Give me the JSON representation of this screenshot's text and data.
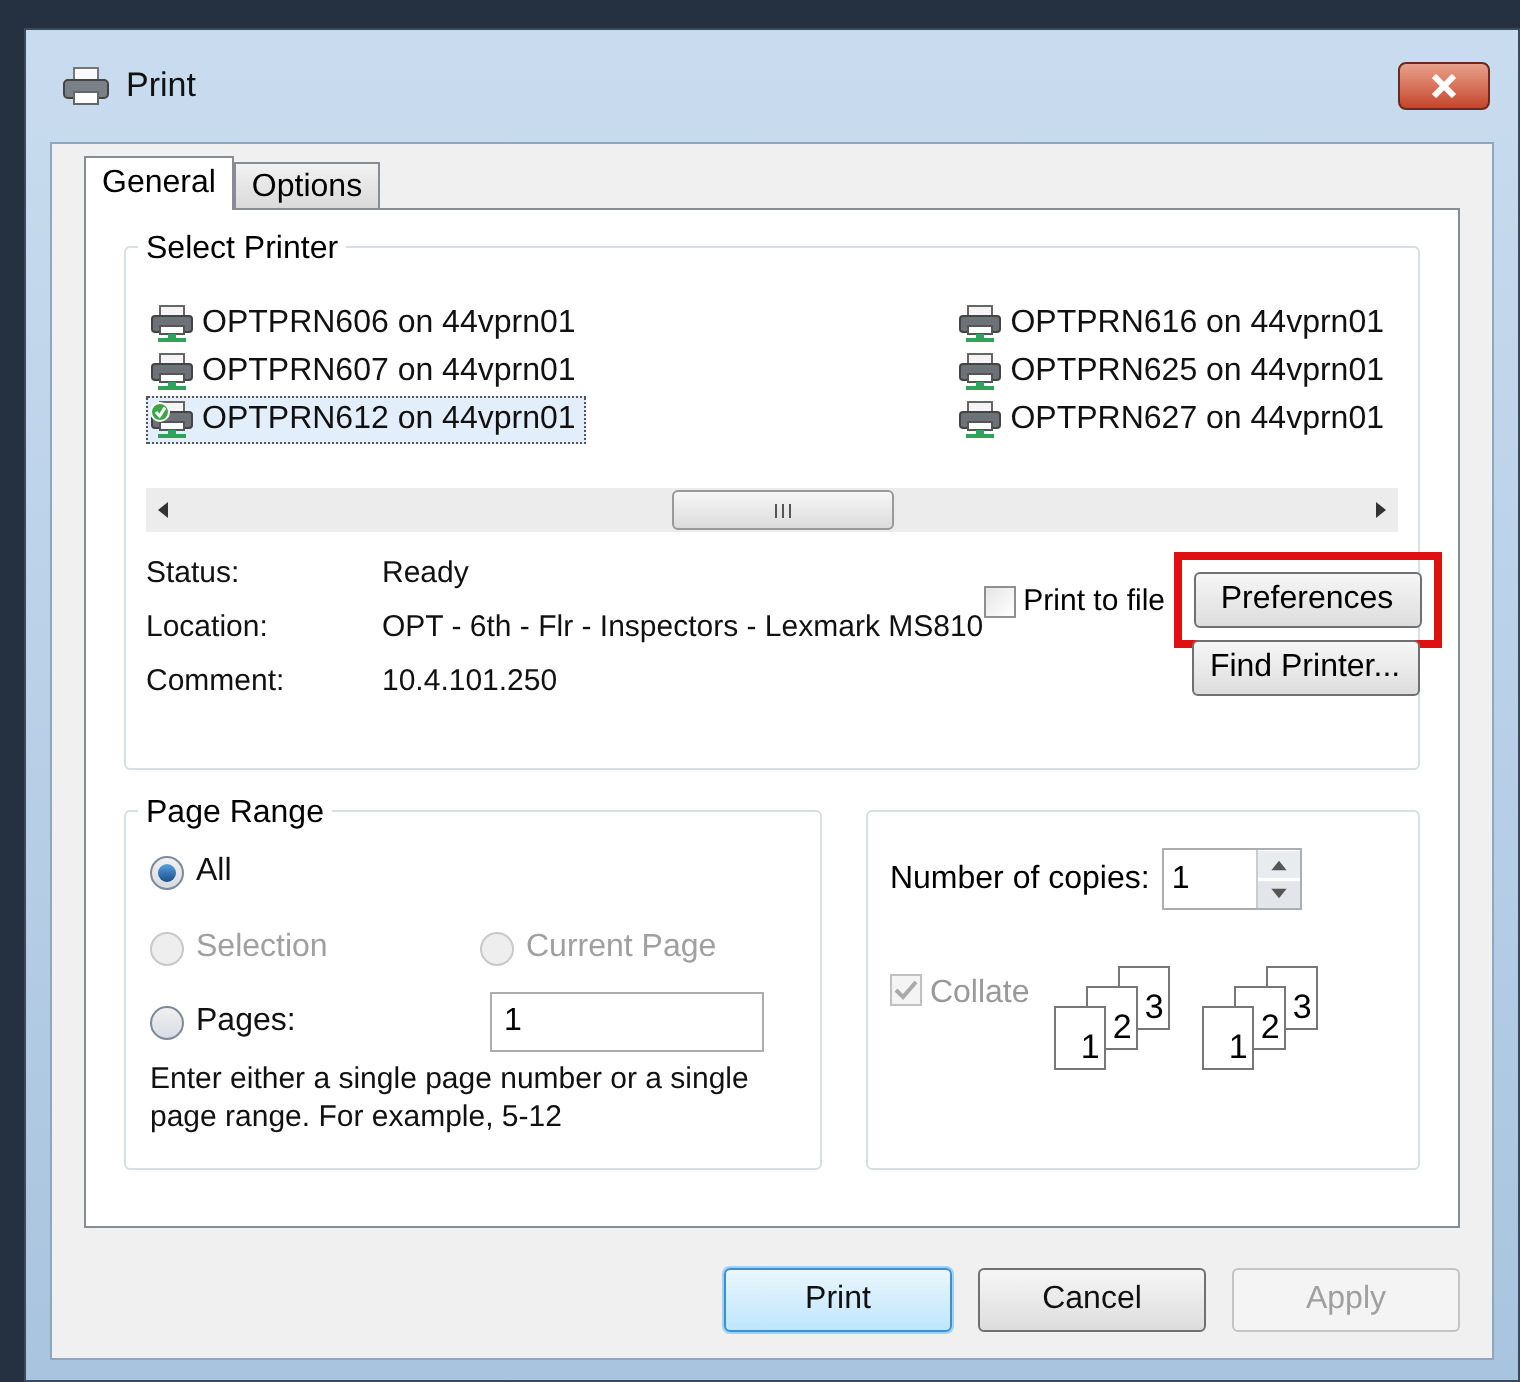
{
  "window": {
    "title": "Print"
  },
  "tabs": [
    {
      "label": "General",
      "selected": true
    },
    {
      "label": "Options",
      "selected": false
    }
  ],
  "select_printer": {
    "title": "Select Printer",
    "printers": [
      {
        "name": "OPTPRN606 on 44vprn01",
        "selected": false,
        "default": false
      },
      {
        "name": "OPTPRN607 on 44vprn01",
        "selected": false,
        "default": false
      },
      {
        "name": "OPTPRN612 on 44vprn01",
        "selected": true,
        "default": true
      },
      {
        "name": "OPTPRN616 on 44vprn01",
        "selected": false,
        "default": false
      },
      {
        "name": "OPTPRN625 on 44vprn01",
        "selected": false,
        "default": false
      },
      {
        "name": "OPTPRN627 on 44vprn01",
        "selected": false,
        "default": false
      }
    ],
    "details": [
      {
        "label": "Status:",
        "value": "Ready"
      },
      {
        "label": "Location:",
        "value": "OPT - 6th - Flr - Inspectors - Lexmark MS810"
      },
      {
        "label": "Comment:",
        "value": "10.4.101.250"
      }
    ],
    "print_to_file": {
      "label": "Print to file",
      "checked": false
    },
    "preferences_button": {
      "label": "Preferences",
      "highlighted": true
    },
    "find_printer_button": {
      "label": "Find Printer..."
    }
  },
  "page_range": {
    "title": "Page Range",
    "options": [
      {
        "label": "All",
        "selected": true,
        "disabled": false
      },
      {
        "label": "Selection",
        "selected": false,
        "disabled": true
      },
      {
        "label": "Current Page",
        "selected": false,
        "disabled": true
      },
      {
        "label": "Pages:",
        "selected": false,
        "disabled": false
      }
    ],
    "pages_value": "1",
    "hint": "Enter either a single page number or a single page range.  For example, 5-12"
  },
  "copies": {
    "label": "Number of copies:",
    "value": "1",
    "collate": {
      "label": "Collate",
      "checked": true,
      "disabled": true
    },
    "collate_icons": [
      {
        "pages": [
          "1",
          "2",
          "3"
        ]
      },
      {
        "pages": [
          "1",
          "2",
          "3"
        ]
      }
    ]
  },
  "buttons": [
    {
      "label": "Print",
      "kind": "default",
      "disabled": false
    },
    {
      "label": "Cancel",
      "kind": "normal",
      "disabled": false
    },
    {
      "label": "Apply",
      "kind": "normal",
      "disabled": true
    }
  ]
}
